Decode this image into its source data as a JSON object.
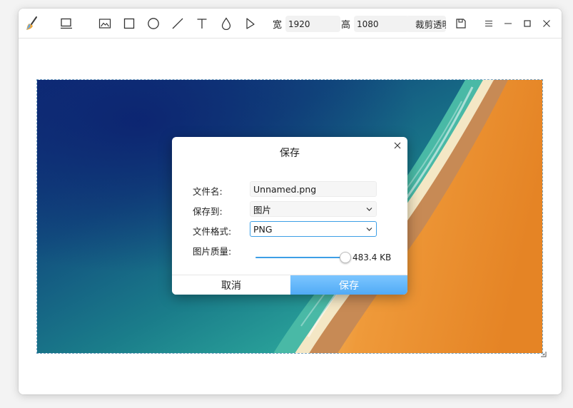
{
  "toolbar": {
    "width_label": "宽",
    "width_value": "1920",
    "height_label": "高",
    "height_value": "1080",
    "crop_button": "裁剪透明",
    "tools": [
      "app-logo-icon",
      "layout-icon",
      "image-icon",
      "rectangle-icon",
      "ellipse-icon",
      "line-icon",
      "text-icon",
      "blur-icon",
      "pen-icon",
      "save-icon"
    ]
  },
  "window_controls": {
    "menu": "menu-icon",
    "minimize": "minimize-icon",
    "maximize": "maximize-icon",
    "close": "close-icon"
  },
  "save_dialog": {
    "title": "保存",
    "filename_label": "文件名:",
    "filename_value": "Unnamed.png",
    "save_to_label": "保存到:",
    "save_to_value": "图片",
    "format_label": "文件格式:",
    "format_value": "PNG",
    "quality_label": "图片质量:",
    "quality_fraction": 0.93,
    "quality_size": "483.4 KB",
    "cancel_label": "取消",
    "save_label": "保存"
  },
  "colors": {
    "accent": "#3d9fe6",
    "save_button": "#5db3f8"
  }
}
